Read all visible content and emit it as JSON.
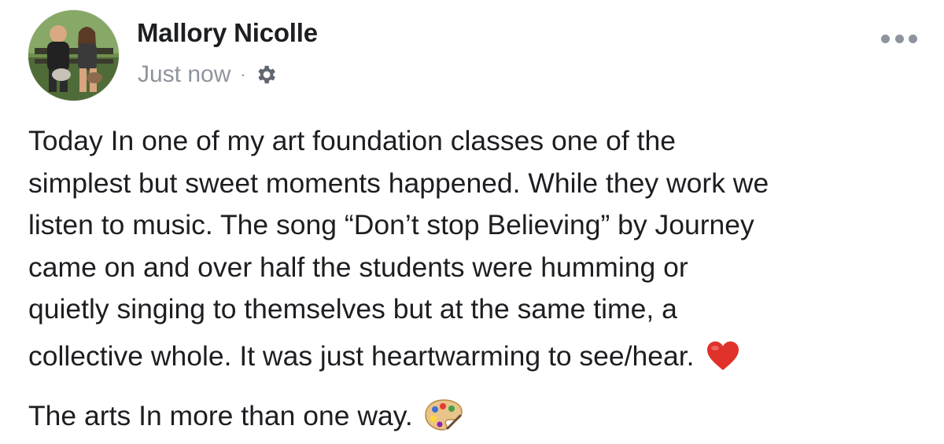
{
  "post": {
    "author": "Mallory Nicolle",
    "timestamp": "Just now",
    "separator": "·",
    "privacy_icon": "gear-icon",
    "menu_icon": "more-options-icon",
    "body_lines": [
      "Today In one of my art foundation classes one of the",
      "simplest but sweet moments happened. While they work we",
      "listen to music. The song “Don’t stop Believing” by Journey",
      "came on and over half the students were humming or",
      "quietly singing to themselves but at the same time, a",
      "collective whole. It was just heartwarming to see/hear.",
      "The arts In more than one way."
    ],
    "emojis": [
      "red-heart-emoji",
      "artist-palette-emoji"
    ]
  },
  "colors": {
    "text": "#1c1e21",
    "secondary_text": "#90949c",
    "icon_gray": "#8d949e",
    "heart": "#e0312b"
  }
}
